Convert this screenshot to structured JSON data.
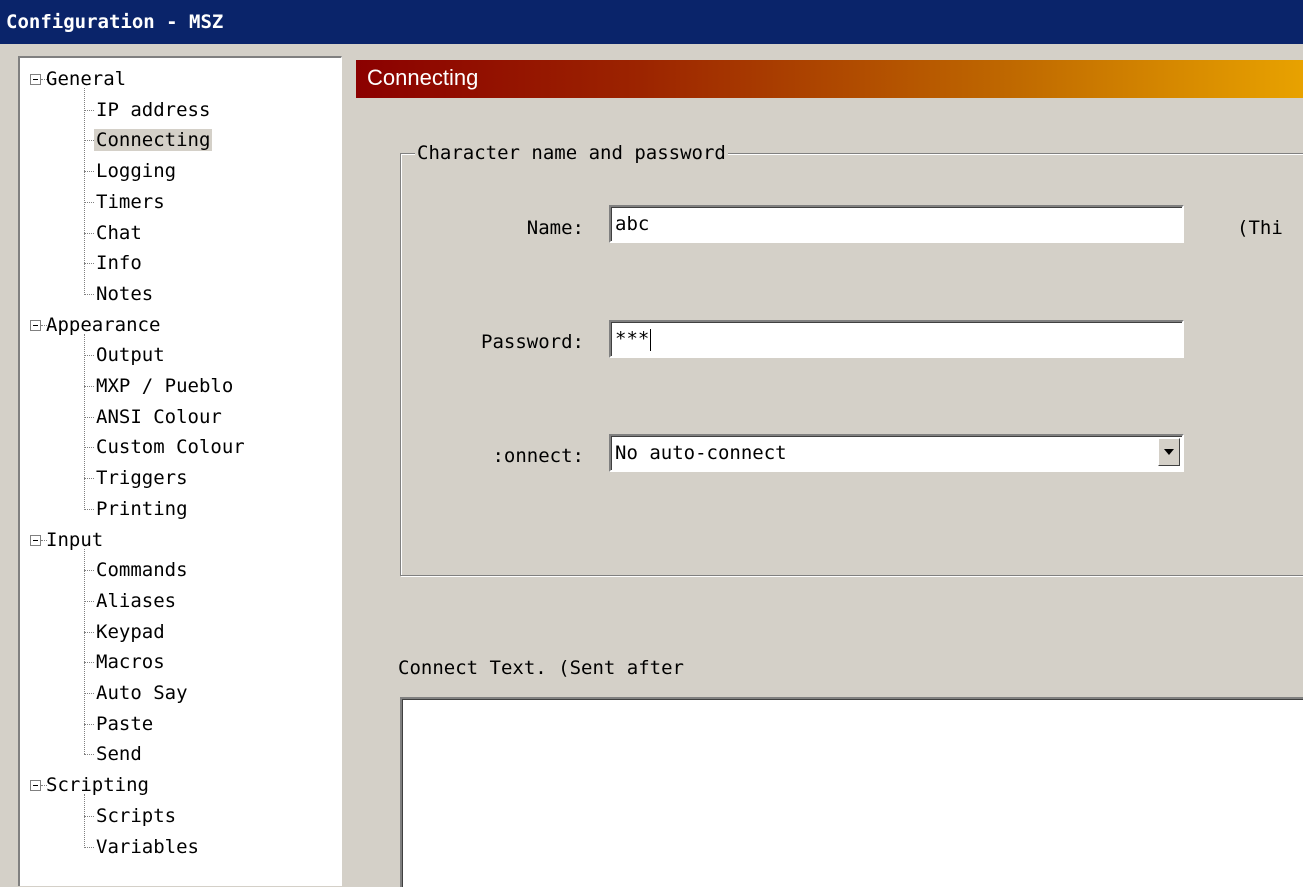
{
  "window": {
    "title": "Configuration - MSZ"
  },
  "tree": {
    "groups": [
      {
        "label": "General",
        "items": [
          "IP address",
          "Connecting",
          "Logging",
          "Timers",
          "Chat",
          "Info",
          "Notes"
        ]
      },
      {
        "label": "Appearance",
        "items": [
          "Output",
          "MXP / Pueblo",
          "ANSI Colour",
          "Custom Colour",
          "Triggers",
          "Printing"
        ]
      },
      {
        "label": "Input",
        "items": [
          "Commands",
          "Aliases",
          "Keypad",
          "Macros",
          "Auto Say",
          "Paste",
          "Send"
        ]
      },
      {
        "label": "Scripting",
        "items": [
          "Scripts",
          "Variables"
        ]
      }
    ],
    "selected": "Connecting"
  },
  "panel": {
    "header": "Connecting",
    "groupbox_title": "Character name and password",
    "name_label": "Name:",
    "name_value": "abc",
    "name_note": "(Thi",
    "password_label": "Password:",
    "password_value": "***",
    "connect_label": ":onnect:",
    "connect_value": "No auto-connect",
    "connect_text_label": "Connect Text. (Sent after"
  },
  "colors": {
    "titlebar": "#0a246a",
    "header_gradient_start": "#8b0000",
    "header_gradient_end": "#e8a200",
    "window_bg": "#d4d0c8"
  }
}
